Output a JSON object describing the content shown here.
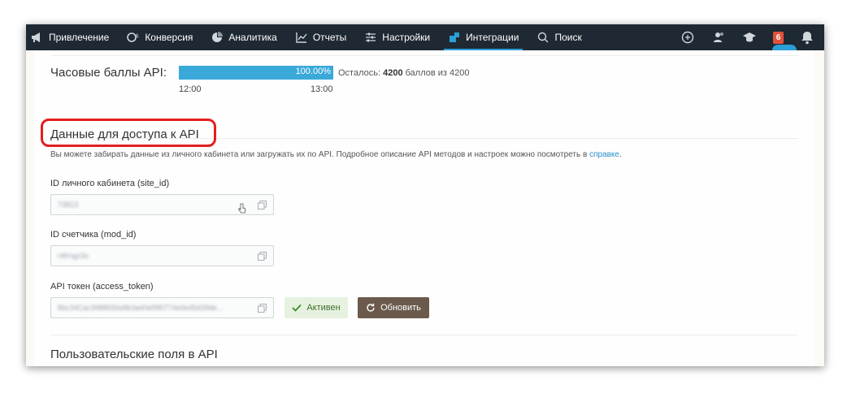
{
  "nav": {
    "items": [
      {
        "label": "Привлечение",
        "icon": "megaphone-icon"
      },
      {
        "label": "Конверсия",
        "icon": "conversion-icon"
      },
      {
        "label": "Аналитика",
        "icon": "analytics-icon"
      },
      {
        "label": "Отчеты",
        "icon": "chart-icon"
      },
      {
        "label": "Настройки",
        "icon": "sliders-icon"
      },
      {
        "label": "Интеграции",
        "icon": "puzzle-icon",
        "active": true
      },
      {
        "label": "Поиск",
        "icon": "search-icon"
      }
    ],
    "notifications_count": "6"
  },
  "api_points": {
    "label": "Часовые баллы API:",
    "percent": "100.00%",
    "fill_fraction": 1.0,
    "remaining_prefix": "Осталось: ",
    "remaining_value": "4200",
    "remaining_suffix": " баллов из 4200",
    "time_start": "12:00",
    "time_end": "13:00"
  },
  "access": {
    "title": "Данные для доступа к API",
    "description": "Вы можете забирать данные из личного кабинета или загружать их по API. Подробное описание API методов и настроек можно посмотреть в ",
    "link": "справке",
    "description_end": ".",
    "site_id_label": "ID личного кабинета (site_id)",
    "site_id_value": "73813",
    "mod_id_label": "ID счетчика (mod_id)",
    "mod_id_value": "r4frngz3o",
    "token_label": "API токен (access_token)",
    "token_value": "8bc34Cac3988656e8b3a40ef9f0774e0e45d39de...",
    "active_label": "Активен",
    "refresh_label": "Обновить"
  },
  "custom_fields": {
    "title": "Пользовательские поля в API"
  }
}
